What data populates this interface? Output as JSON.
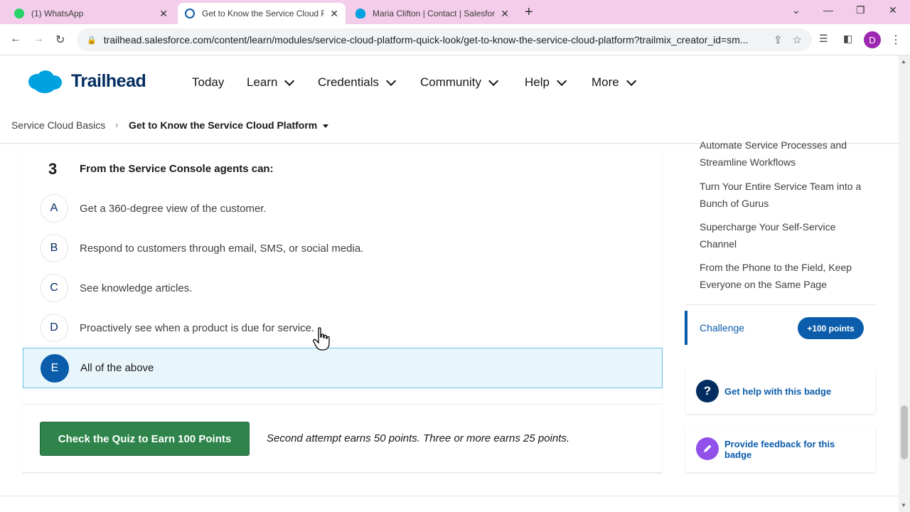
{
  "browser": {
    "tabs": [
      {
        "title": "(1) WhatsApp",
        "icon": "whatsapp-icon",
        "color": "#25d366"
      },
      {
        "title": "Get to Know the Service Cloud Platform",
        "icon": "trailhead-icon",
        "color": "#0b5cab"
      },
      {
        "title": "Maria Clifton | Contact | Salesforce",
        "icon": "salesforce-icon",
        "color": "#00a1e0"
      }
    ],
    "url": "trailhead.salesforce.com/content/learn/modules/service-cloud-platform-quick-look/get-to-know-the-service-cloud-platform?trailmix_creator_id=sm...",
    "profile_initial": "D"
  },
  "header": {
    "logo_text": "Trailhead",
    "menu": [
      {
        "label": "Today",
        "dropdown": false
      },
      {
        "label": "Learn",
        "dropdown": true
      },
      {
        "label": "Credentials",
        "dropdown": true
      },
      {
        "label": "Community",
        "dropdown": true
      },
      {
        "label": "Help",
        "dropdown": true
      },
      {
        "label": "More",
        "dropdown": true
      }
    ]
  },
  "breadcrumb": {
    "parent": "Service Cloud Basics",
    "current": "Get to Know the Service Cloud Platform"
  },
  "quiz": {
    "question_number": "3",
    "question_text": "From the Service Console agents can:",
    "options": [
      {
        "letter": "A",
        "text": "Get a 360-degree view of the customer.",
        "selected": false
      },
      {
        "letter": "B",
        "text": "Respond to customers through email, SMS, or social media.",
        "selected": false
      },
      {
        "letter": "C",
        "text": "See knowledge articles.",
        "selected": false
      },
      {
        "letter": "D",
        "text": "Proactively see when a product is due for service.",
        "selected": false
      },
      {
        "letter": "E",
        "text": "All of the above",
        "selected": true
      }
    ],
    "submit_label": "Check the Quiz to Earn 100 Points",
    "attempt_note": "Second attempt earns 50 points. Three or more earns 25 points."
  },
  "sidebar": {
    "units": [
      "Automate Service Processes and Streamline Workflows",
      "Turn Your Entire Service Team into a Bunch of Gurus",
      "Supercharge Your Self-Service Channel",
      "From the Phone to the Field, Keep Everyone on the Same Page"
    ],
    "challenge_label": "Challenge",
    "points_badge": "+100 points",
    "help_label": "Get help with this badge",
    "feedback_label": "Provide feedback for this badge"
  },
  "colors": {
    "brand_blue": "#0b5cab",
    "navy": "#032d60",
    "submit_green": "#2e844a",
    "selected_bg": "#e8f6fb",
    "tabstrip": "#f3cdea"
  }
}
